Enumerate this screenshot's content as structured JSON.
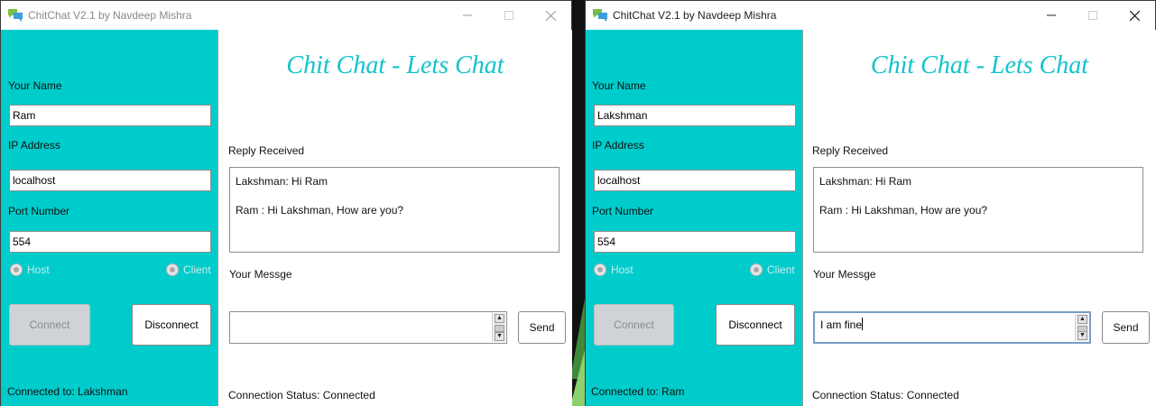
{
  "windows": [
    {
      "title": "ChitChat V2.1 by Navdeep Mishra",
      "active": false,
      "sidebar": {
        "name_label": "Your Name",
        "name_value": "Ram",
        "ip_label": "IP Address",
        "ip_value": "localhost",
        "port_label": "Port Number",
        "port_value": "554",
        "radio_host": "Host",
        "radio_client": "Client",
        "connect_label": "Connect",
        "disconnect_label": "Disconnect",
        "connected_to": "Connected to: Lakshman"
      },
      "main": {
        "heading": "Chit Chat - Lets Chat",
        "reply_label": "Reply Received",
        "replies": [
          "Lakshman: Hi Ram",
          "Ram : Hi Lakshman, How are you?"
        ],
        "message_label": "Your Messge",
        "message_value": "",
        "send_label": "Send",
        "status": "Connection Status: Connected"
      }
    },
    {
      "title": "ChitChat V2.1 by Navdeep Mishra",
      "active": true,
      "sidebar": {
        "name_label": "Your Name",
        "name_value": "Lakshman",
        "ip_label": "IP Address",
        "ip_value": "localhost",
        "port_label": "Port Number",
        "port_value": "554",
        "radio_host": "Host",
        "radio_client": "Client",
        "connect_label": "Connect",
        "disconnect_label": "Disconnect",
        "connected_to": "Connected to: Ram"
      },
      "main": {
        "heading": "Chit Chat - Lets Chat",
        "reply_label": "Reply Received",
        "replies": [
          "Lakshman: Hi Ram",
          "Ram : Hi Lakshman, How are you?"
        ],
        "message_label": "Your Messge",
        "message_value": "I am fine",
        "send_label": "Send",
        "status": "Connection Status: Connected"
      }
    }
  ],
  "colors": {
    "sidebar": "#00cccc",
    "heading": "#13c2cc"
  }
}
